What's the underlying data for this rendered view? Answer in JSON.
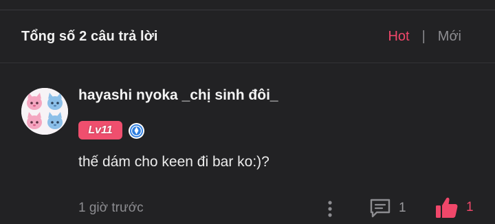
{
  "header": {
    "title": "Tổng số 2 câu trả lời",
    "sort_hot": "Hot",
    "sort_separator": "|",
    "sort_new": "Mới"
  },
  "comment": {
    "avatar_icon": "kitten-sticker-avatar",
    "username": "hayashi nyoka _chị sinh đôi_",
    "level": "Lv11",
    "badge_icon": "verified-badge-icon",
    "text": "thế dám cho keen đi bar ko:)?",
    "time": "1 giờ trước",
    "reply_count": "1",
    "like_count": "1"
  },
  "colors": {
    "background": "#222224",
    "accent": "#f0476a",
    "level_badge": "#ef4f6e",
    "muted_text": "#8d8d91"
  }
}
